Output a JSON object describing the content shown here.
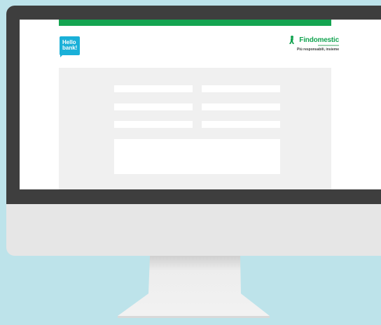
{
  "logos": {
    "hello_bank": "Hello bank!",
    "findomestic": "Findomestic",
    "findomestic_tagline": "Più responsabili, insieme"
  },
  "colors": {
    "background": "#bde3ea",
    "bezel": "#3e3e3e",
    "chin": "#e6e6e6",
    "accent_green": "#14a451",
    "hello_blue": "#1ab0d8",
    "form_panel": "#f0f0f0"
  },
  "icons": {
    "findomestic_mark": "runner-figure-icon"
  }
}
